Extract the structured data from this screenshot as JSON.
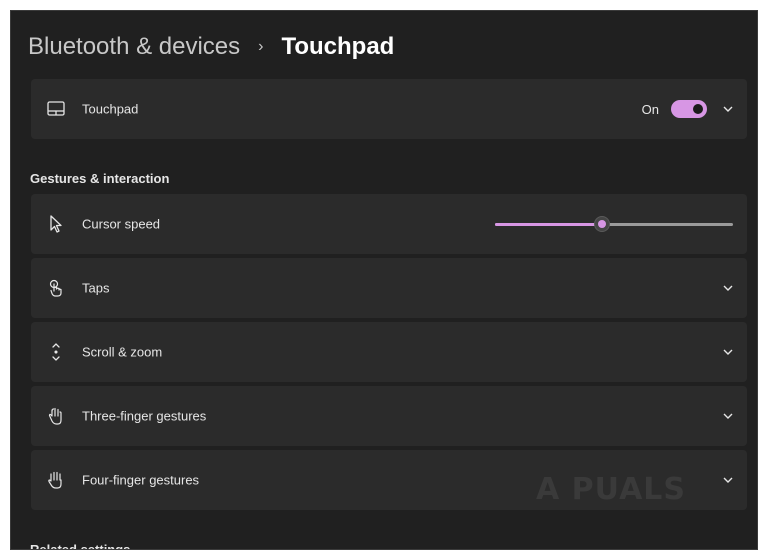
{
  "breadcrumb": {
    "parent": "Bluetooth & devices",
    "separator": "›",
    "current": "Touchpad"
  },
  "touchpad_card": {
    "label": "Touchpad",
    "icon": "touchpad-icon",
    "toggle_state": "On",
    "toggle_on": true
  },
  "section": {
    "gestures_header": "Gestures & interaction",
    "related_header": "Related settings"
  },
  "cursor_speed": {
    "label": "Cursor speed",
    "icon": "cursor-icon",
    "value_fraction": 0.45
  },
  "items": [
    {
      "label": "Taps",
      "icon": "tap-hand-icon"
    },
    {
      "label": "Scroll & zoom",
      "icon": "scroll-arrows-icon"
    },
    {
      "label": "Three-finger gestures",
      "icon": "three-finger-hand-icon"
    },
    {
      "label": "Four-finger gestures",
      "icon": "four-finger-hand-icon"
    }
  ],
  "watermark": {
    "text": "A PUALS"
  },
  "colors": {
    "accent": "#d796e4",
    "background": "#202020",
    "card": "#2b2b2b"
  }
}
